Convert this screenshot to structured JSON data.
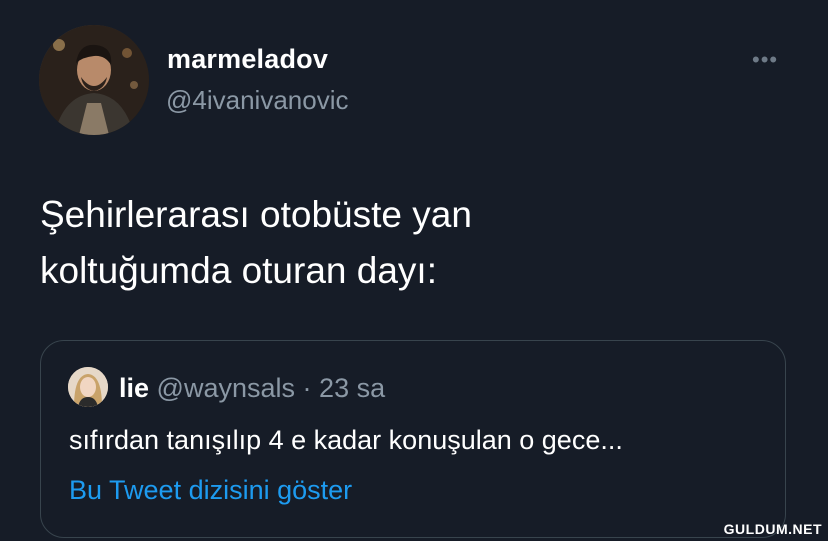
{
  "author": {
    "display_name": "marmeladov",
    "handle": "@4ivanivanovic",
    "more_label": "•••"
  },
  "tweet": {
    "line1": "Şehirlerarası otobüste yan",
    "line2": "koltuğumda oturan dayı:"
  },
  "quoted": {
    "display_name": "lie",
    "handle": "@waynsals",
    "separator": "·",
    "time": "23 sa",
    "text": "sıfırdan tanışılıp 4 e kadar konuşulan o gece...",
    "thread_link": "Bu Tweet dizisini göster"
  },
  "watermark": "GULDUM.NET",
  "colors": {
    "background": "#161c27",
    "secondary_text": "#8b98a5",
    "link": "#1d9bf0",
    "border": "#38444d"
  }
}
